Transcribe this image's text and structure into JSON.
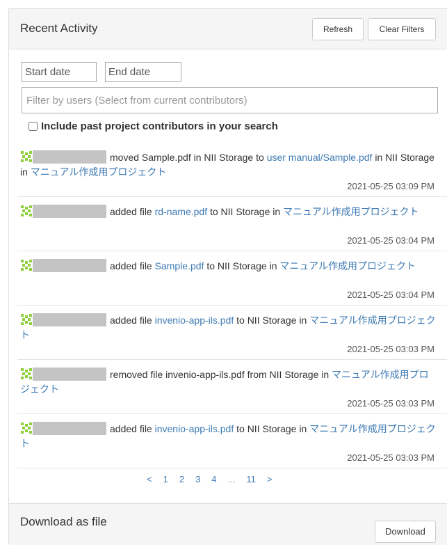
{
  "header": {
    "title": "Recent Activity",
    "refresh_label": "Refresh",
    "clear_label": "Clear Filters"
  },
  "filters": {
    "start_placeholder": "Start date",
    "end_placeholder": "End date",
    "users_placeholder": "Filter by users (Select from current contributors)",
    "past_contributors_label": "Include past project contributors in your search"
  },
  "activities": [
    {
      "pre": "moved Sample.pdf in NII Storage to ",
      "link1": "user manual/Sample.pdf",
      "mid": " in NII Storage in ",
      "link2": "マニュアル作成用プロジェクト",
      "time": "2021-05-25 03:09 PM"
    },
    {
      "pre": "added file ",
      "link1": "rd-name.pdf",
      "mid": " to NII Storage in ",
      "link2": "マニュアル作成用プロジェクト",
      "time": "2021-05-25 03:04 PM"
    },
    {
      "pre": "added file ",
      "link1": "Sample.pdf",
      "mid": " to NII Storage in ",
      "link2": "マニュアル作成用プロジェクト",
      "time": "2021-05-25 03:04 PM"
    },
    {
      "pre": "added file ",
      "link1": "invenio-app-ils.pdf",
      "mid": " to NII Storage in ",
      "link2": "マニュアル作成用プロジェクト",
      "time": "2021-05-25 03:03 PM"
    },
    {
      "pre": "removed file invenio-app-ils.pdf from NII Storage in ",
      "link1": "",
      "mid": "",
      "link2": "マニュアル作成用プロジェクト",
      "time": "2021-05-25 03:03 PM"
    },
    {
      "pre": "added file ",
      "link1": "invenio-app-ils.pdf",
      "mid": " to NII Storage in ",
      "link2": "マニュアル作成用プロジェクト",
      "time": "2021-05-25 03:03 PM"
    }
  ],
  "pagination": {
    "prev": "<",
    "pages": [
      "1",
      "2",
      "3",
      "4"
    ],
    "ellipsis": "...",
    "last": "11",
    "next": ">"
  },
  "download": {
    "title": "Download as file",
    "button_label": "Download"
  },
  "colors": {
    "link": "#3d7ab3",
    "avatar": "#8fcf3c"
  }
}
